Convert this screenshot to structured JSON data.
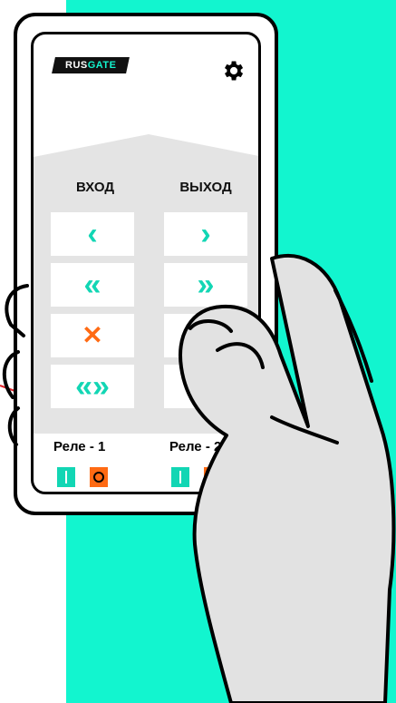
{
  "brand": {
    "rus": "RUS",
    "gate": "GATE"
  },
  "columns": {
    "in_label": "ВХОД",
    "out_label": "ВЫХОД"
  },
  "in_buttons": [
    {
      "icon": "chevron-left-icon",
      "glyph": "‹",
      "color": "teal"
    },
    {
      "icon": "double-chevron-left-icon",
      "glyph": "«",
      "color": "teal"
    },
    {
      "icon": "close-icon",
      "glyph": "✕",
      "color": "orange"
    },
    {
      "icon": "double-chevron-both-icon",
      "glyph": "«»",
      "color": "teal"
    }
  ],
  "out_buttons": [
    {
      "icon": "chevron-right-icon",
      "glyph": "›",
      "color": "teal"
    },
    {
      "icon": "double-chevron-right-icon",
      "glyph": "»",
      "color": "teal"
    },
    {
      "icon": "hidden",
      "glyph": "",
      "color": "teal"
    },
    {
      "icon": "double-chevron-right-icon",
      "glyph": "»",
      "color": "orange"
    }
  ],
  "relays": [
    {
      "label": "Реле - 1"
    },
    {
      "label": "Реле - 2"
    }
  ],
  "colors": {
    "accent": "#12f5cf",
    "teal_icon": "#12d6b4",
    "orange": "#ff6a13",
    "panel": "#e4e4e4"
  }
}
